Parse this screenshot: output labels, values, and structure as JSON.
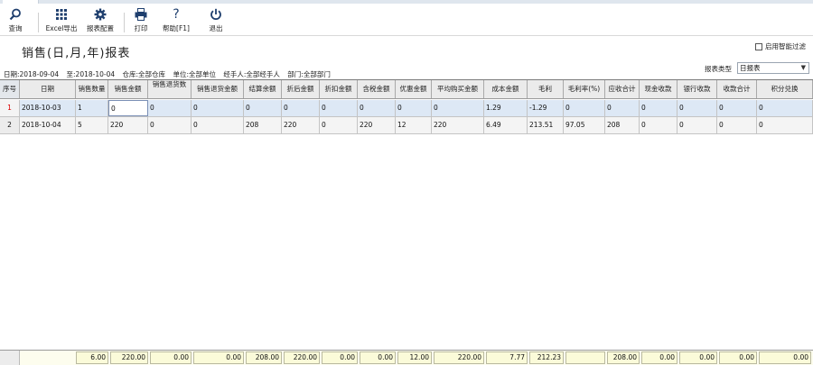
{
  "toolbar": {
    "query": "查询",
    "excel": "Excel导出",
    "config": "报表配置",
    "print": "打印",
    "help": "帮助[F1]",
    "exit": "退出"
  },
  "page": {
    "title": "销售(日,月,年)报表"
  },
  "smart_filter": {
    "label": "启用智能过滤",
    "checked": false
  },
  "report_type": {
    "label": "报表类型",
    "value": "日报表"
  },
  "filters": {
    "date_from": "日期:2018-09-04",
    "date_to": "至:2018-10-04",
    "warehouse": "仓库:全部仓库",
    "unit": "单位:全部单位",
    "handler": "经手人:全部经手人",
    "dept": "部门:全部部门"
  },
  "columns": [
    "序号",
    "日期",
    "销售数量",
    "销售金额",
    "销售退货数",
    "销售退货金额",
    "结算余额",
    "折后金额",
    "折扣金额",
    "含税金额",
    "优惠金额",
    "平均购买金额",
    "成本金额",
    "毛利",
    "毛利率(%)",
    "应收合计",
    "现金收款",
    "银行收款",
    "收款合计",
    "积分兑换"
  ],
  "rows": [
    [
      "1",
      "2018-10-03",
      "1",
      "0",
      "0",
      "0",
      "0",
      "0",
      "0",
      "0",
      "0",
      "0",
      "1.29",
      "-1.29",
      "0",
      "0",
      "0",
      "0",
      "0",
      "0"
    ],
    [
      "2",
      "2018-10-04",
      "5",
      "220",
      "0",
      "0",
      "208",
      "220",
      "0",
      "220",
      "12",
      "220",
      "6.49",
      "213.51",
      "97.05",
      "208",
      "0",
      "0",
      "0",
      "0"
    ]
  ],
  "totals": [
    "6.00",
    "220.00",
    "0.00",
    "0.00",
    "208.00",
    "220.00",
    "0.00",
    "0.00",
    "12.00",
    "220.00",
    "7.77",
    "212.23",
    "",
    "208.00",
    "0.00",
    "0.00",
    "0.00",
    "0.00"
  ]
}
